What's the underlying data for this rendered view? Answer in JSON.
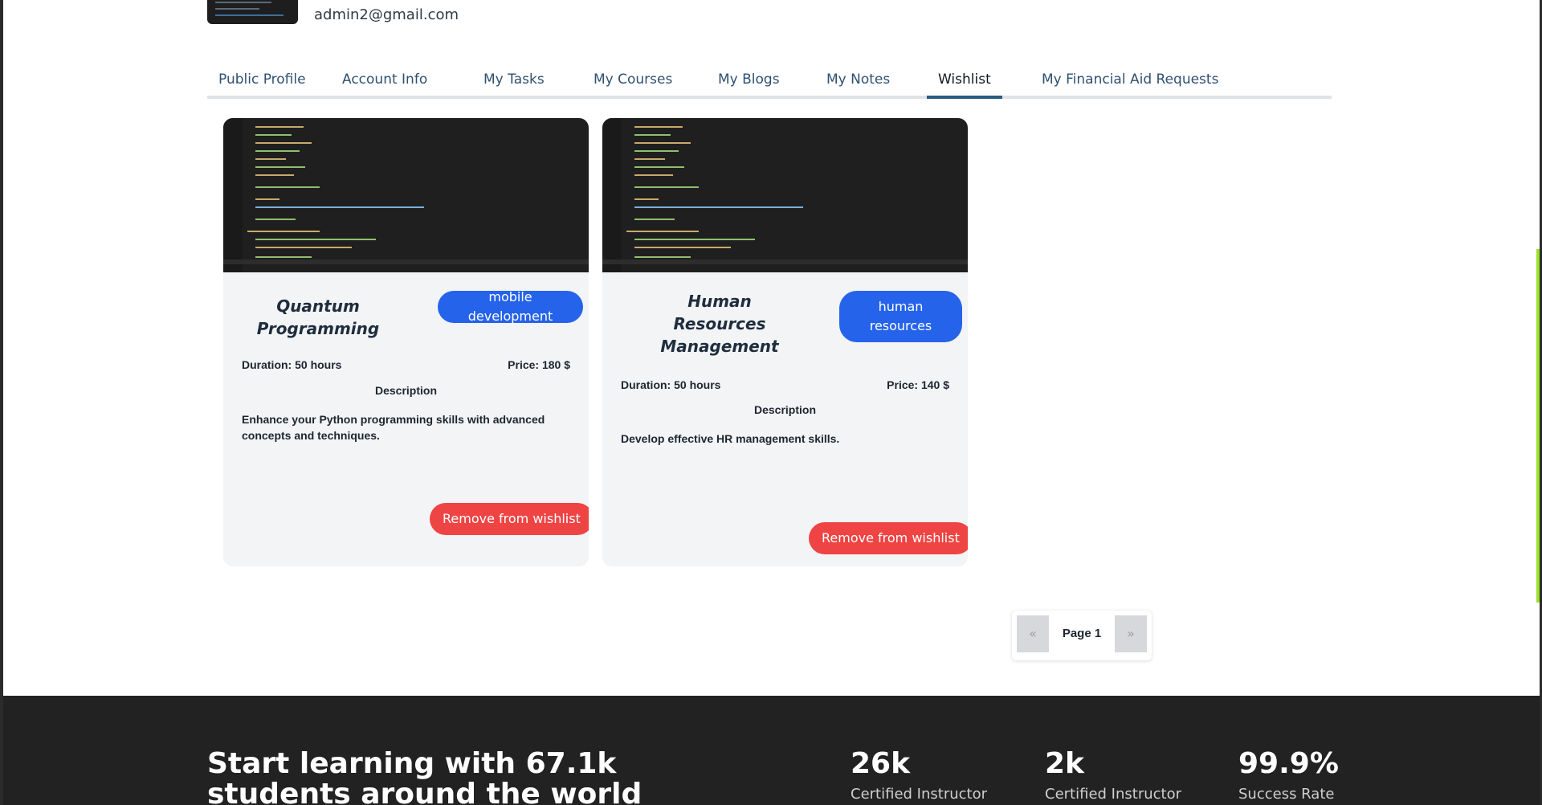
{
  "profile": {
    "email": "admin2@gmail.com"
  },
  "tabs": [
    {
      "label": "Public Profile"
    },
    {
      "label": "Account Info"
    },
    {
      "label": "My Tasks"
    },
    {
      "label": "My Courses"
    },
    {
      "label": "My Blogs"
    },
    {
      "label": "My Notes"
    },
    {
      "label": "Wishlist",
      "active": true
    },
    {
      "label": "My Financial Aid Requests"
    }
  ],
  "wishlist": [
    {
      "title": "Quantum Programming",
      "category": "mobile development",
      "duration": "Duration: 50 hours",
      "price": "Price: 180 $",
      "description_heading": "Description",
      "description": "Enhance your Python programming skills with advanced concepts and techniques.",
      "remove_label": "Remove from wishlist"
    },
    {
      "title": "Human Resources Management",
      "category": "human resources",
      "duration": "Duration: 50 hours",
      "price": "Price: 140 $",
      "description_heading": "Description",
      "description": "Develop effective HR management skills.",
      "remove_label": "Remove from wishlist"
    }
  ],
  "pagination": {
    "prev": "«",
    "page_label": "Page 1",
    "next": "»"
  },
  "footer": {
    "heading": "Start learning with 67.1k students around the world",
    "stats": [
      {
        "value": "26k",
        "label": "Certified Instructor"
      },
      {
        "value": "2k",
        "label": "Certified Instructor"
      },
      {
        "value": "99.9%",
        "label": "Success Rate"
      }
    ]
  },
  "colors": {
    "badge": "#2563eb",
    "remove_button": "#ef4444",
    "footer_bg": "#222222",
    "active_tab_underline": "#2b5a82"
  }
}
